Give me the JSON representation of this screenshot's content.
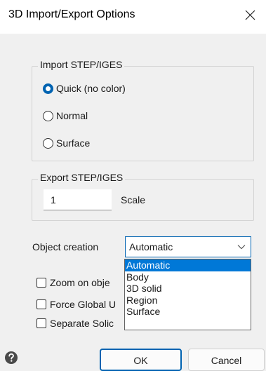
{
  "window": {
    "title": "3D Import/Export Options",
    "close_icon": "close-icon"
  },
  "import_group": {
    "title": "Import STEP/IGES",
    "options": [
      {
        "label": "Quick (no color)",
        "checked": true
      },
      {
        "label": "Normal",
        "checked": false
      },
      {
        "label": "Surface",
        "checked": false
      }
    ]
  },
  "export_group": {
    "title": "Export STEP/IGES",
    "scale_value": "1",
    "scale_label": "Scale"
  },
  "object_creation": {
    "label": "Object creation",
    "selected": "Automatic",
    "options": [
      "Automatic",
      "Body",
      "3D solid",
      "Region",
      "Surface"
    ]
  },
  "checkboxes": [
    {
      "label": "Zoom on obje",
      "checked": false
    },
    {
      "label": "Force Global U",
      "checked": false
    },
    {
      "label": "Separate Solic",
      "checked": false
    }
  ],
  "footer": {
    "help_icon": "help-icon",
    "ok_label": "OK",
    "cancel_label": "Cancel"
  },
  "colors": {
    "accent": "#0063b1",
    "selection": "#0078d7",
    "background": "#f0f0f0"
  }
}
